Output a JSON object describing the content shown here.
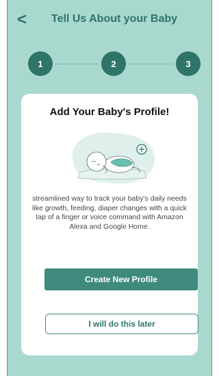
{
  "header": {
    "back_label": "<",
    "title": "Tell Us About your Baby"
  },
  "steps": [
    "1",
    "2",
    "3"
  ],
  "card": {
    "title": "Add Your Baby's Profile!",
    "description": "streamlined way to track your baby's daily needs like growth, feeding, diaper changes with a quick tap of a finger or voice command with Amazon Alexa and Google Home.",
    "primary_button": "Create New Profile",
    "secondary_button": "I will do this later"
  },
  "colors": {
    "background": "#a9d8cf",
    "accent": "#2f7468",
    "button": "#3f8a7d"
  },
  "icons": {
    "back": "back-arrow-icon",
    "illustration": "sleeping-baby-illustration"
  }
}
